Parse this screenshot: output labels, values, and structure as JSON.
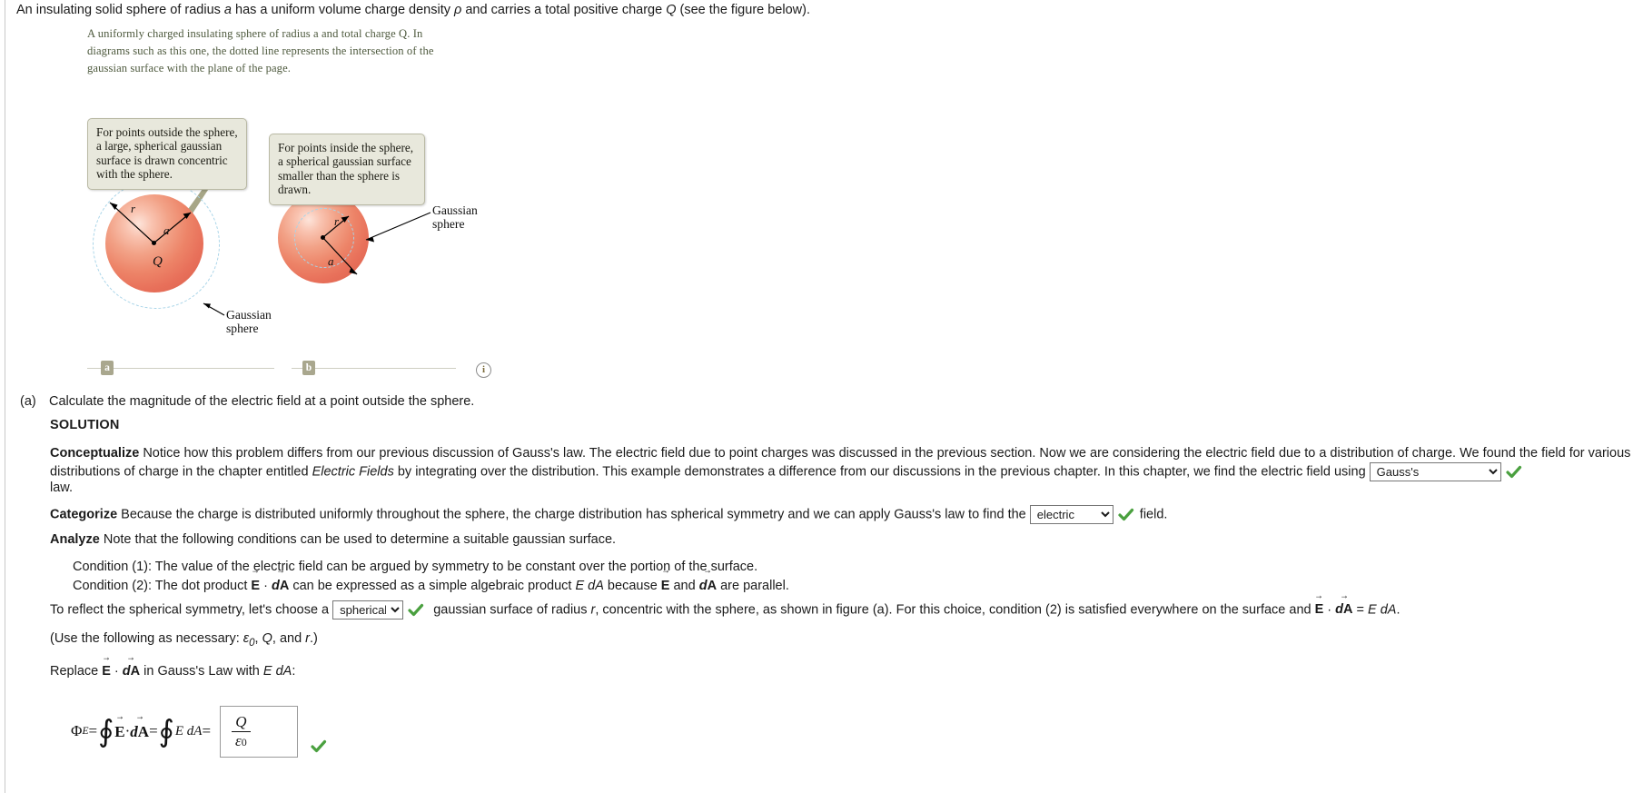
{
  "problem": {
    "statement_pre": "An insulating solid sphere of radius ",
    "statement_var_a": "a",
    "statement_mid1": " has a uniform volume charge density ",
    "statement_rho": "ρ",
    "statement_mid2": " and carries a total positive charge ",
    "statement_var_Q": "Q",
    "statement_post": " (see the figure below)."
  },
  "figure": {
    "caption": "A uniformly charged insulating sphere of radius a and total charge Q. In diagrams such as this one, the dotted line represents the intersection of the gaussian surface with the plane of the page.",
    "callout_a": "For points outside the sphere, a large, spherical gaussian surface is drawn concentric with the sphere.",
    "callout_b": "For points inside the sphere, a spherical gaussian surface smaller than the sphere is drawn.",
    "label_r": "r",
    "label_a": "a",
    "label_Q": "Q",
    "gaussian_label_line1": "Gaussian",
    "gaussian_label_line2": "sphere",
    "part_a_chip": "a",
    "part_b_chip": "b",
    "info_glyph": "i"
  },
  "question": {
    "label": "(a)",
    "text": "Calculate the magnitude of the electric field at a point outside the sphere.",
    "solution_heading": "SOLUTION"
  },
  "conceptualize": {
    "term": "Conceptualize",
    "text_1": " Notice how this problem differs from our previous discussion of Gauss's law. The electric field due to point charges was discussed in the previous section. Now we are considering the electric field due to a distribution of charge. We found the field for various distributions of charge in the chapter entitled ",
    "italic_title": "Electric Fields",
    "text_2": " by integrating over the distribution. This example demonstrates a difference from our discussions in the previous chapter. In this chapter, we find the electric field using ",
    "select_value": "Gauss's",
    "text_after": "law."
  },
  "categorize": {
    "term": "Categorize",
    "text_1": " Because the charge is distributed uniformly throughout the sphere, the charge distribution has spherical symmetry and we can apply Gauss's law to find the ",
    "select_value": "electric",
    "text_2": "field."
  },
  "analyze": {
    "term": "Analyze",
    "text": " Note that the following conditions can be used to determine a suitable gaussian surface.",
    "condition_1": "Condition (1): The value of the electric field can be argued by symmetry to be constant over the portion of the surface.",
    "condition_2_pre": "Condition (2): The dot product ",
    "condition_2_E": "E",
    "condition_2_dot": " · ",
    "condition_2_dA_d": "d",
    "condition_2_dA_A": "A",
    "condition_2_mid": " can be expressed as a simple algebraic product ",
    "condition_2_EdA": "E dA",
    "condition_2_because": " because ",
    "condition_2_and": " and ",
    "condition_2_end": " are parallel."
  },
  "reflect": {
    "text_1": "To reflect the spherical symmetry, let's choose a ",
    "select_value": "spherical",
    "text_2": "gaussian surface of radius ",
    "radius_var": "r",
    "text_3": ", concentric with the sphere, as shown in figure (a). For this choice, condition (2) is satisfied everywhere on the surface and ",
    "text_4": " = ",
    "text_5": "E dA",
    "text_6": "."
  },
  "use_note": {
    "pre": "(Use the following as necessary: ",
    "eps": "ε",
    "eps_sub": "0",
    "mid": ", ",
    "Q": "Q",
    "and": ", and ",
    "r": "r",
    "post": ".)"
  },
  "replace_line": {
    "pre": "Replace ",
    "dot": " · ",
    "mid": " in Gauss's Law with ",
    "EdA": "E dA",
    "post": ":"
  },
  "equation": {
    "phi": "Φ",
    "phi_sub": "E",
    "eq1": " = ",
    "oint": "∮",
    "dot": " · ",
    "eq2": " = ",
    "EdA": "E dA",
    "eq3": " = ",
    "answer_numerator": "Q",
    "answer_denominator_eps": "ε",
    "answer_denominator_sub": "0"
  },
  "colors": {
    "check_green": "#4aa03f",
    "callout_bg": "#e8e8dc",
    "callout_border": "#b9b9a4",
    "chip_bg": "#a9a78e",
    "sphere_red": "#e8705a",
    "dashed_blue": "#a8d4e8",
    "caption_text": "#4e5a3e"
  },
  "selects": {
    "conceptualize_options": [
      "Gauss's"
    ],
    "categorize_options": [
      "electric"
    ],
    "reflect_options": [
      "spherical"
    ]
  }
}
